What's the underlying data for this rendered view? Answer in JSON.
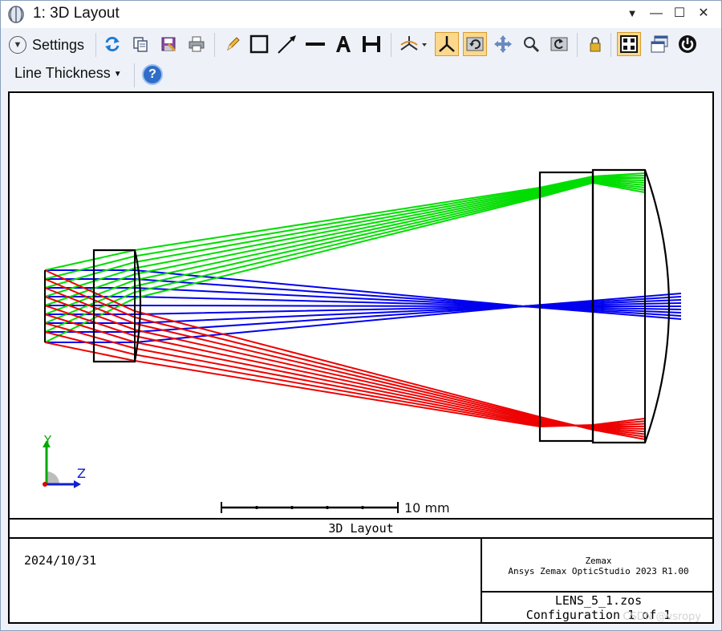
{
  "window": {
    "title": "1: 3D Layout",
    "controls": {
      "menu": "▼",
      "minimize": "—",
      "maximize": "☐",
      "close": "✕"
    }
  },
  "toolbar": {
    "settings_label": "Settings",
    "line_thickness_label": "Line Thickness",
    "icons": [
      "refresh-icon",
      "copy-icon",
      "save-icon",
      "print-icon",
      "pencil-icon",
      "rectangle-icon",
      "arrow-icon",
      "line-icon",
      "text-icon",
      "dimension-icon",
      "rotate-view-icon",
      "axes-icon",
      "reset-view-icon",
      "pan-icon",
      "zoom-icon",
      "undo-zoom-icon",
      "lock-icon",
      "tile-icon",
      "window-icon",
      "power-icon",
      "help-icon"
    ],
    "active": [
      "axes-icon",
      "reset-view-icon",
      "tile-icon"
    ]
  },
  "plot": {
    "scale_bar_label": "10 mm",
    "axis_labels": {
      "y": "Y",
      "z": "Z"
    },
    "footer": {
      "title": "3D Layout",
      "date": "2024/10/31",
      "company": "Zemax",
      "product": "Ansys Zemax OpticStudio 2023 R1.00",
      "file": "LENS_5_1.zos",
      "configuration": "Configuration 1 of 1"
    },
    "watermark": "CSDN @vsropy",
    "ray_colors": {
      "field1": "#00dd00",
      "field2": "#0000ee",
      "field3": "#ee0000"
    }
  }
}
